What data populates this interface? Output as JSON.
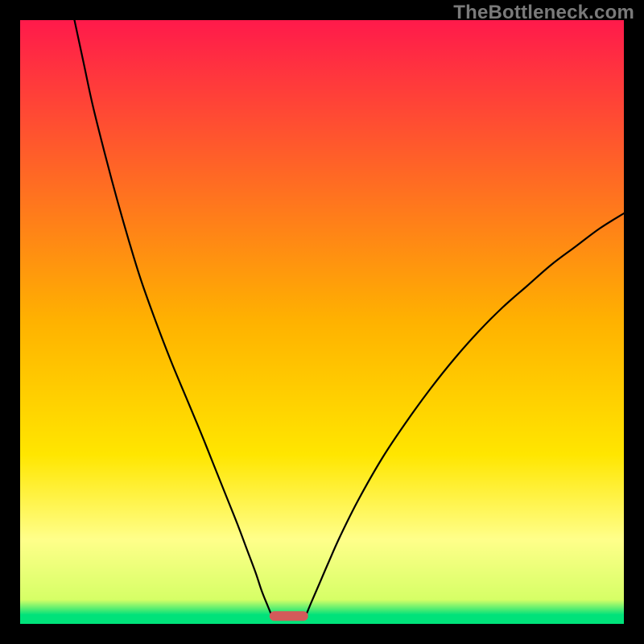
{
  "watermark": "TheBottleneck.com",
  "chart_data": {
    "type": "line",
    "title": "",
    "xlabel": "",
    "ylabel": "",
    "xlim": [
      0,
      100
    ],
    "ylim": [
      0,
      100
    ],
    "grid": false,
    "legend": false,
    "background_gradient": {
      "stops": [
        {
          "offset": 0.0,
          "color": "#ff1a4b"
        },
        {
          "offset": 0.5,
          "color": "#ffb200"
        },
        {
          "offset": 0.72,
          "color": "#ffe600"
        },
        {
          "offset": 0.86,
          "color": "#ffff8a"
        },
        {
          "offset": 0.96,
          "color": "#d6ff66"
        },
        {
          "offset": 0.985,
          "color": "#00e27a"
        },
        {
          "offset": 1.0,
          "color": "#00e27a"
        }
      ]
    },
    "series": [
      {
        "name": "left-curve",
        "stroke": "#000000",
        "stroke_width": 2.2,
        "points": [
          {
            "x": 9.0,
            "y": 100.0
          },
          {
            "x": 10.5,
            "y": 93.0
          },
          {
            "x": 12.0,
            "y": 86.0
          },
          {
            "x": 14.0,
            "y": 78.0
          },
          {
            "x": 16.0,
            "y": 70.5
          },
          {
            "x": 18.0,
            "y": 63.5
          },
          {
            "x": 20.0,
            "y": 57.0
          },
          {
            "x": 22.5,
            "y": 50.0
          },
          {
            "x": 25.0,
            "y": 43.5
          },
          {
            "x": 27.5,
            "y": 37.5
          },
          {
            "x": 30.0,
            "y": 31.5
          },
          {
            "x": 32.0,
            "y": 26.5
          },
          {
            "x": 34.0,
            "y": 21.5
          },
          {
            "x": 36.0,
            "y": 16.5
          },
          {
            "x": 37.5,
            "y": 12.5
          },
          {
            "x": 39.0,
            "y": 8.5
          },
          {
            "x": 40.0,
            "y": 5.5
          },
          {
            "x": 41.0,
            "y": 3.0
          },
          {
            "x": 41.7,
            "y": 1.3
          }
        ]
      },
      {
        "name": "right-curve",
        "stroke": "#000000",
        "stroke_width": 2.2,
        "points": [
          {
            "x": 47.3,
            "y": 1.3
          },
          {
            "x": 48.2,
            "y": 3.5
          },
          {
            "x": 49.5,
            "y": 6.5
          },
          {
            "x": 51.0,
            "y": 10.0
          },
          {
            "x": 53.0,
            "y": 14.5
          },
          {
            "x": 56.0,
            "y": 20.5
          },
          {
            "x": 60.0,
            "y": 27.5
          },
          {
            "x": 64.0,
            "y": 33.5
          },
          {
            "x": 68.0,
            "y": 39.0
          },
          {
            "x": 72.0,
            "y": 44.0
          },
          {
            "x": 76.0,
            "y": 48.5
          },
          {
            "x": 80.0,
            "y": 52.5
          },
          {
            "x": 84.0,
            "y": 56.0
          },
          {
            "x": 88.0,
            "y": 59.5
          },
          {
            "x": 92.0,
            "y": 62.5
          },
          {
            "x": 96.0,
            "y": 65.5
          },
          {
            "x": 100.0,
            "y": 68.0
          }
        ]
      }
    ],
    "marker": {
      "name": "optimal-range-marker",
      "shape": "capsule",
      "fill": "#d35a5a",
      "x_center": 44.5,
      "y_center": 1.3,
      "width": 6.4,
      "height": 1.6
    }
  }
}
